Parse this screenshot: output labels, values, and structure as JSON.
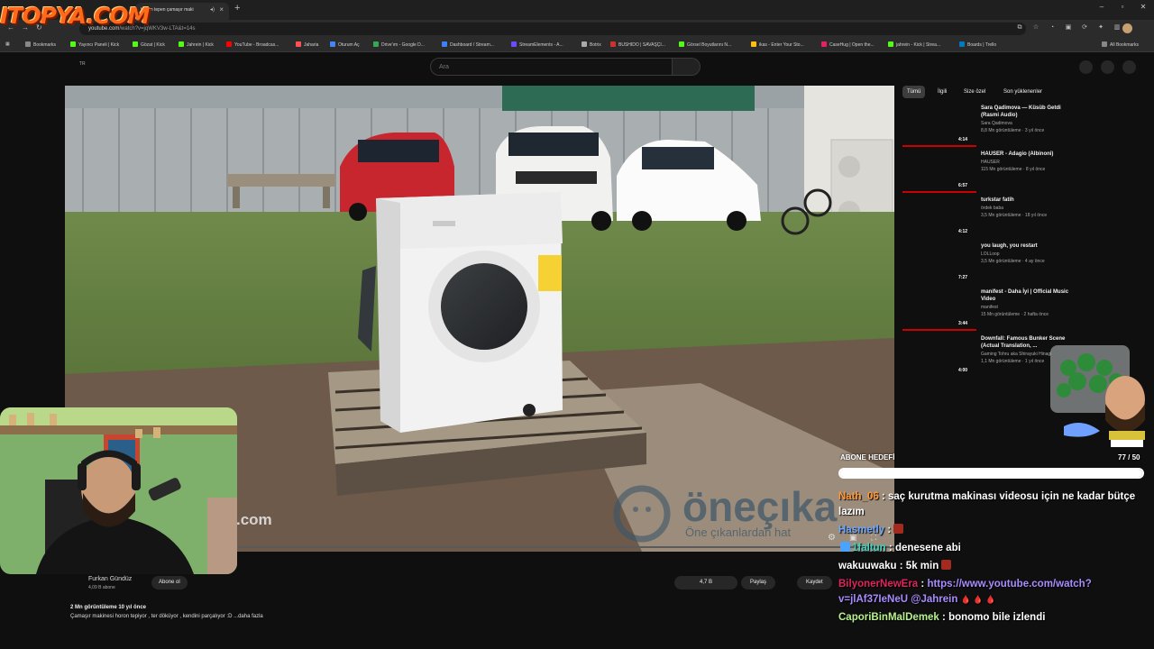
{
  "browser": {
    "active_tab_title": "Horon tepen çamaşır maki",
    "url_host": "youtube.com",
    "url_path": "/watch?v=jqWKV3w-LTA&t=14s",
    "all_bookmarks": "All Bookmarks"
  },
  "bookmarks": [
    {
      "label": "Bookmarks",
      "color": "#888888"
    },
    {
      "label": "Yayıncı Paneli | Kick",
      "color": "#53fc18"
    },
    {
      "label": "Gözat | Kick",
      "color": "#53fc18"
    },
    {
      "label": "Jahrein | Kick",
      "color": "#53fc18"
    },
    {
      "label": "YouTube - Broadcas...",
      "color": "#ff0000"
    },
    {
      "label": "Jaharia",
      "color": "#ff5252"
    },
    {
      "label": "Oturum Aç",
      "color": "#4285f4"
    },
    {
      "label": "Drive'ım - Google D...",
      "color": "#34a853"
    },
    {
      "label": "Dashboard / Stream...",
      "color": "#3b82f6"
    },
    {
      "label": "StreamElements - A...",
      "color": "#6d4aff"
    },
    {
      "label": "Botrix",
      "color": "#aaaaaa"
    },
    {
      "label": "BUSHIDO | SAVAŞÇI...",
      "color": "#d32f2f"
    },
    {
      "label": "Görsel Boyutlarını N...",
      "color": "#53fc18"
    },
    {
      "label": "ikas - Enter Your Sto...",
      "color": "#ffc107"
    },
    {
      "label": "CaseHug | Open the...",
      "color": "#e91e63"
    },
    {
      "label": "jahrein - Kick | Strea...",
      "color": "#53fc18"
    },
    {
      "label": "Boards | Trello",
      "color": "#0079bf"
    }
  ],
  "youtube": {
    "region": "TR",
    "search_placeholder": "Ara",
    "chips": [
      "Tümü",
      "İlgili",
      "Size özel",
      "Son yüklenenler"
    ],
    "recommendations": [
      {
        "title": "Sara Qadimova — Küsüb Getdi (Rasmi Audio)",
        "channel": "Sara Qadimova",
        "meta": "8,8 Mn görüntüleme · 3 yıl önce",
        "duration": "4:14",
        "watched": 1.0
      },
      {
        "title": "HAUSER - Adagio (Albinoni)",
        "channel": "HAUSER",
        "meta": "115 Mn görüntüleme · 8 yıl önce",
        "duration": "6:57",
        "watched": 1.0
      },
      {
        "title": "turkstar fatih",
        "channel": "ördek baba",
        "meta": "3,5 Mn görüntüleme · 18 yıl önce",
        "duration": "4:12",
        "watched": 0
      },
      {
        "title": "you laugh, you restart",
        "channel": "LOLLoop",
        "meta": "3,5 Mn görüntüleme · 4 ay önce",
        "duration": "7:27",
        "watched": 0
      },
      {
        "title": "manifest - Daha İyi | Official Music Video",
        "channel": "manifest",
        "meta": "15 Mn görüntüleme · 2 hafta önce",
        "duration": "3:44",
        "watched": 1.0
      },
      {
        "title": "Downfall: Famous Bunker Scene (Actual Translation, ...",
        "channel": "Gaming Tohru aka Shirayuki Hinagi",
        "meta": "1,1 Mn görüntüleme · 1 yıl önce",
        "duration": "4:00",
        "watched": 0
      }
    ],
    "channel_name": "Furkan Gündüz",
    "channel_subs": "4,09 B abone",
    "subscribe_label": "Abone ol",
    "likes": "4,7 B",
    "share_label": "Paylaş",
    "save_label": "Kaydet",
    "views_age": "2 Mn görüntüleme  10 yıl önce",
    "description": "Çamaşır makinesi horon tepiyor , ter döküyor , kendini parçalıyor :D ...daha fazla",
    "watermark": "öneçıka",
    "watermark_sub": "Öne çıkanlardan hat",
    "video_corner_text": ".com"
  },
  "overlay": {
    "logo_text": "ITOPYA.COM",
    "goal_label": "ABONE HEDEFİ",
    "goal_count": "77 / 50",
    "goal_fraction": 1.0
  },
  "chat": [
    {
      "user": "Nath_06",
      "user_color": "#ff9a3c",
      "text": "saç kurutma makinası videosu için ne kadar bütçe lazım",
      "badge": ""
    },
    {
      "user": "Hasmetly",
      "user_color": "#6fa8ff",
      "text": "",
      "badge": "",
      "emote": true
    },
    {
      "user": "1faltun",
      "user_color": "#3fd4c4",
      "text": "denesene abi",
      "badge": "#4aa3ff"
    },
    {
      "user": "wakuuwaku",
      "user_color": "#ffffff",
      "text": "5k min",
      "badge": "",
      "emote_after": true
    },
    {
      "user": "BilyonerNewEra",
      "user_color": "#e0245e",
      "text": "",
      "link": "https://www.youtube.com/watch?v=jlAf37IeNeU",
      "mention": "@Jahrein",
      "drops": true
    },
    {
      "user": "CaporiBinMalDemek",
      "user_color": "#b8f28c",
      "text": "bonomo bile izlendi",
      "badge": ""
    }
  ]
}
